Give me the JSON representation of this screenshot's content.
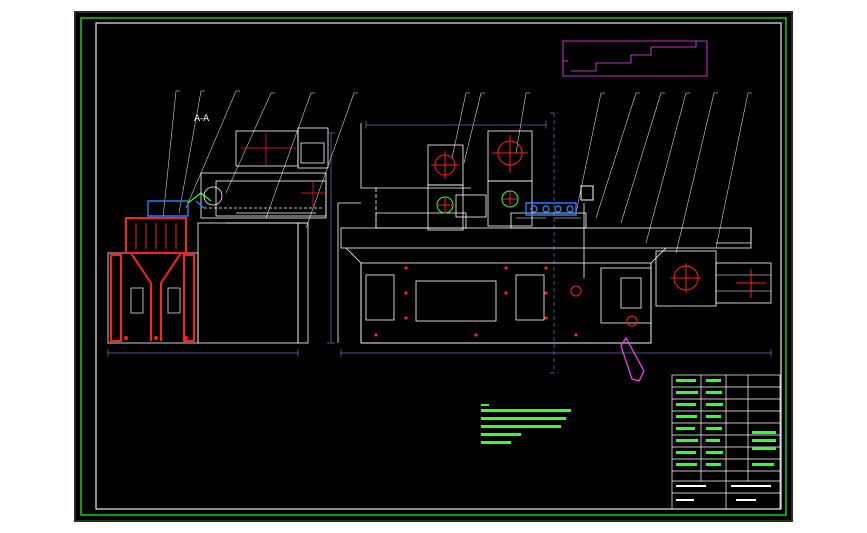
{
  "drawing": {
    "section_label": "A-A",
    "colors": {
      "background": "#000000",
      "frame": "#ffffff",
      "border": "#1aff1a",
      "machine": "#ffffff",
      "section": "#ff2020",
      "motor_cross": "#ff2020",
      "dimension": "#9fa4ff",
      "callout": "#cfcfcf",
      "notes": "#33ff33",
      "magenta": "#ff40ff",
      "blue": "#2a7bff"
    }
  }
}
